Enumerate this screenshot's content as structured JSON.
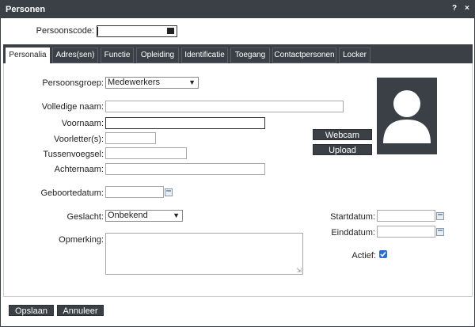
{
  "window": {
    "title": "Personen",
    "help": "?",
    "close": "×"
  },
  "persoonscode": {
    "label": "Persoonscode:",
    "value": ""
  },
  "tabs": [
    {
      "label": "Personalia",
      "active": true
    },
    {
      "label": "Adres(sen)"
    },
    {
      "label": "Functie"
    },
    {
      "label": "Opleiding"
    },
    {
      "label": "Identificatie"
    },
    {
      "label": "Toegang"
    },
    {
      "label": "Contactpersonen"
    },
    {
      "label": "Locker"
    }
  ],
  "form": {
    "persoonsgroep": {
      "label": "Persoonsgroep:",
      "value": "Medewerkers"
    },
    "volledige_naam": {
      "label": "Volledige naam:",
      "value": ""
    },
    "voornaam": {
      "label": "Voornaam:",
      "value": ""
    },
    "voorletters": {
      "label": "Voorletter(s):",
      "value": ""
    },
    "tussenvoegsel": {
      "label": "Tussenvoegsel:",
      "value": ""
    },
    "achternaam": {
      "label": "Achternaam:",
      "value": ""
    },
    "geboortedatum": {
      "label": "Geboortedatum:",
      "value": ""
    },
    "geslacht": {
      "label": "Geslacht:",
      "value": "Onbekend"
    },
    "opmerking": {
      "label": "Opmerking:",
      "value": ""
    },
    "startdatum": {
      "label": "Startdatum:",
      "value": ""
    },
    "einddatum": {
      "label": "Einddatum:",
      "value": ""
    },
    "actief": {
      "label": "Actief:",
      "checked": true
    }
  },
  "photo": {
    "webcam_label": "Webcam",
    "upload_label": "Upload"
  },
  "footer": {
    "save_label": "Opslaan",
    "cancel_label": "Annuleer"
  },
  "colors": {
    "dark": "#3b4046",
    "checkbox": "#2a6fd6"
  }
}
